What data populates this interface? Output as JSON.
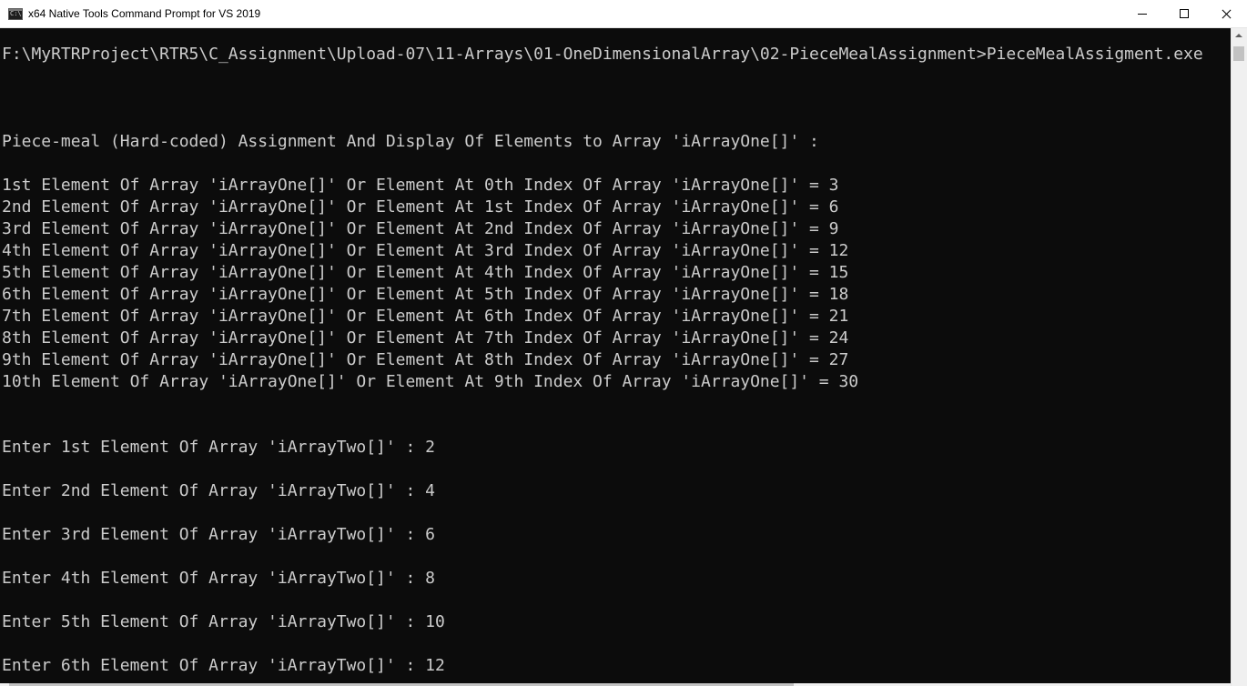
{
  "window": {
    "title": "x64 Native Tools Command Prompt for VS 2019",
    "icon": "cmd-icon",
    "icon_text": "C:\\."
  },
  "console": {
    "lines": [
      "",
      "F:\\MyRTRProject\\RTR5\\C_Assignment\\Upload-07\\11-Arrays\\01-OneDimensionalArray\\02-PieceMealAssignment>PieceMealAssigment.exe",
      "",
      "",
      "",
      "Piece-meal (Hard-coded) Assignment And Display Of Elements to Array 'iArrayOne[]' :",
      "",
      "1st Element Of Array 'iArrayOne[]' Or Element At 0th Index Of Array 'iArrayOne[]' = 3",
      "2nd Element Of Array 'iArrayOne[]' Or Element At 1st Index Of Array 'iArrayOne[]' = 6",
      "3rd Element Of Array 'iArrayOne[]' Or Element At 2nd Index Of Array 'iArrayOne[]' = 9",
      "4th Element Of Array 'iArrayOne[]' Or Element At 3rd Index Of Array 'iArrayOne[]' = 12",
      "5th Element Of Array 'iArrayOne[]' Or Element At 4th Index Of Array 'iArrayOne[]' = 15",
      "6th Element Of Array 'iArrayOne[]' Or Element At 5th Index Of Array 'iArrayOne[]' = 18",
      "7th Element Of Array 'iArrayOne[]' Or Element At 6th Index Of Array 'iArrayOne[]' = 21",
      "8th Element Of Array 'iArrayOne[]' Or Element At 7th Index Of Array 'iArrayOne[]' = 24",
      "9th Element Of Array 'iArrayOne[]' Or Element At 8th Index Of Array 'iArrayOne[]' = 27",
      "10th Element Of Array 'iArrayOne[]' Or Element At 9th Index Of Array 'iArrayOne[]' = 30",
      "",
      "",
      "Enter 1st Element Of Array 'iArrayTwo[]' : 2",
      "",
      "Enter 2nd Element Of Array 'iArrayTwo[]' : 4",
      "",
      "Enter 3rd Element Of Array 'iArrayTwo[]' : 6",
      "",
      "Enter 4th Element Of Array 'iArrayTwo[]' : 8",
      "",
      "Enter 5th Element Of Array 'iArrayTwo[]' : 10",
      "",
      "Enter 6th Element Of Array 'iArrayTwo[]' : 12"
    ]
  },
  "colors": {
    "console_background": "#0c0c0c",
    "console_text": "#cccccc",
    "titlebar_background": "#ffffff"
  }
}
